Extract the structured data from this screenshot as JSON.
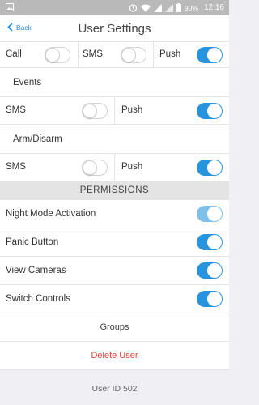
{
  "statusbar": {
    "battery": "90%",
    "time": "12:16"
  },
  "navbar": {
    "back_label": "Back",
    "title": "User Settings"
  },
  "top_row": {
    "call": "Call",
    "sms": "SMS",
    "push": "Push"
  },
  "events": {
    "heading": "Events",
    "sms": "SMS",
    "push": "Push"
  },
  "arm_disarm": {
    "heading": "Arm/Disarm",
    "sms": "SMS",
    "push": "Push"
  },
  "permissions": {
    "heading": "PERMISSIONS",
    "items": [
      {
        "label": "Night Mode Activation",
        "state": "on-disabled"
      },
      {
        "label": "Panic Button",
        "state": "on"
      },
      {
        "label": "View Cameras",
        "state": "on"
      },
      {
        "label": "Switch Controls",
        "state": "on"
      }
    ]
  },
  "groups_label": "Groups",
  "delete_label": "Delete User",
  "user_id_label": "User ID 502",
  "colors": {
    "accent": "#2893df",
    "delete": "#e0453b",
    "header_bg": "#e4e4e4"
  }
}
